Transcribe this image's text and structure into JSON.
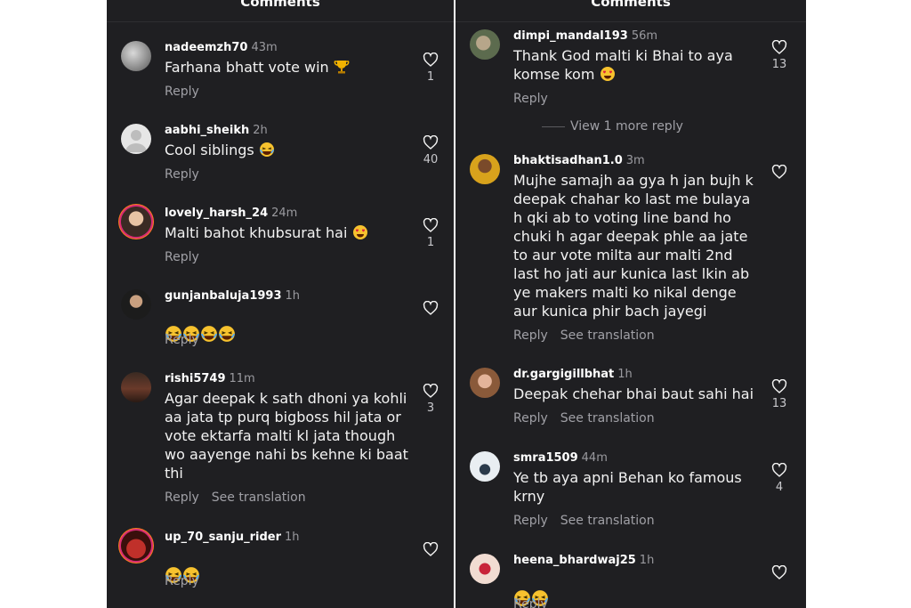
{
  "panels": {
    "left": {
      "title": "Comments",
      "comments": [
        {
          "username": "nadeemzh70",
          "time": "43m",
          "text": "Farhana bhatt vote win",
          "likes": "1",
          "reply": "Reply"
        },
        {
          "username": "aabhi_sheikh",
          "time": "2h",
          "text": "Cool siblings",
          "likes": "40",
          "reply": "Reply"
        },
        {
          "username": "lovely_harsh_24",
          "time": "24m",
          "text": "Malti bahot khubsurat hai",
          "likes": "1",
          "reply": "Reply"
        },
        {
          "username": "gunjanbaluja1993",
          "time": "1h",
          "text": "",
          "likes": "",
          "reply": "Reply"
        },
        {
          "username": "rishi5749",
          "time": "11m",
          "text": "Agar deepak k sath dhoni ya kohli\naa jata tp purq bigboss hil jata or\nvote ektarfa malti kl jata though\nwo aayenge nahi bs kehne ki baat\nthi",
          "likes": "3",
          "reply": "Reply",
          "see_translation": "See translation"
        },
        {
          "username": "up_70_sanju_rider",
          "time": "1h",
          "text": "",
          "likes": "",
          "reply": "Reply"
        }
      ]
    },
    "right": {
      "title": "Comments",
      "comments": [
        {
          "username": "dimpi_mandal193",
          "time": "56m",
          "text": "Thank God malti ki Bhai to aya\nkomse kom",
          "likes": "13",
          "reply": "Reply",
          "view_more": "View 1 more reply"
        },
        {
          "username": "bhaktisadhan1.0",
          "time": "3m",
          "text": "Mujhe samajh aa gya h jan bujh k\ndeepak chahar ko last me bulaya\nh qki ab to voting line band ho\nchuki h agar deepak phle aa jate\nto aur vote milta aur malti 2nd\nlast ho jati aur kunica last lkin ab\nye makers malti ko nikal denge\naur kunica phir bach jayegi",
          "likes": "",
          "reply": "Reply",
          "see_translation": "See translation"
        },
        {
          "username": "dr.gargigillbhat",
          "time": "1h",
          "text": "Deepak chehar bhai baut sahi hai",
          "likes": "13",
          "reply": "Reply",
          "see_translation": "See translation"
        },
        {
          "username": "smra1509",
          "time": "44m",
          "text": "Ye tb aya apni Behan ko famous\nkrny",
          "likes": "4",
          "reply": "Reply",
          "see_translation": "See translation"
        },
        {
          "username": "heena_bhardwaj25",
          "time": "1h",
          "text": "",
          "likes": "",
          "reply": "Reply"
        }
      ]
    }
  },
  "colors": {
    "panel_bg": "#1f1f22",
    "text": "#f2f2f2",
    "muted": "#a0a0a6",
    "story_ring": "#d62976"
  },
  "icons": {
    "like": "heart-outline-icon",
    "laugh": "laughing-face-icon",
    "trophy": "trophy-icon",
    "heart_eyes": "heart-eyes-icon"
  }
}
